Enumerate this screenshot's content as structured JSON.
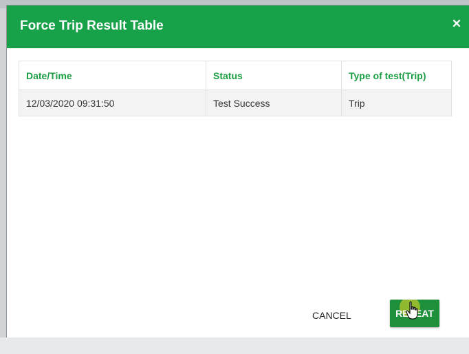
{
  "dialog": {
    "title": "Force Trip Result Table",
    "close_icon": "close-icon"
  },
  "table": {
    "columns": [
      "Date/Time",
      "Status",
      "Type of test(Trip)"
    ],
    "rows": [
      [
        "12/03/2020 09:31:50",
        "Test Success",
        "Trip"
      ]
    ]
  },
  "actions": {
    "cancel_label": "CANCEL",
    "repeat_label": "REPEAT"
  },
  "colors": {
    "header": "#17a24a",
    "accent_text": "#1a9d43",
    "primary_button": "#1e8f3b"
  }
}
